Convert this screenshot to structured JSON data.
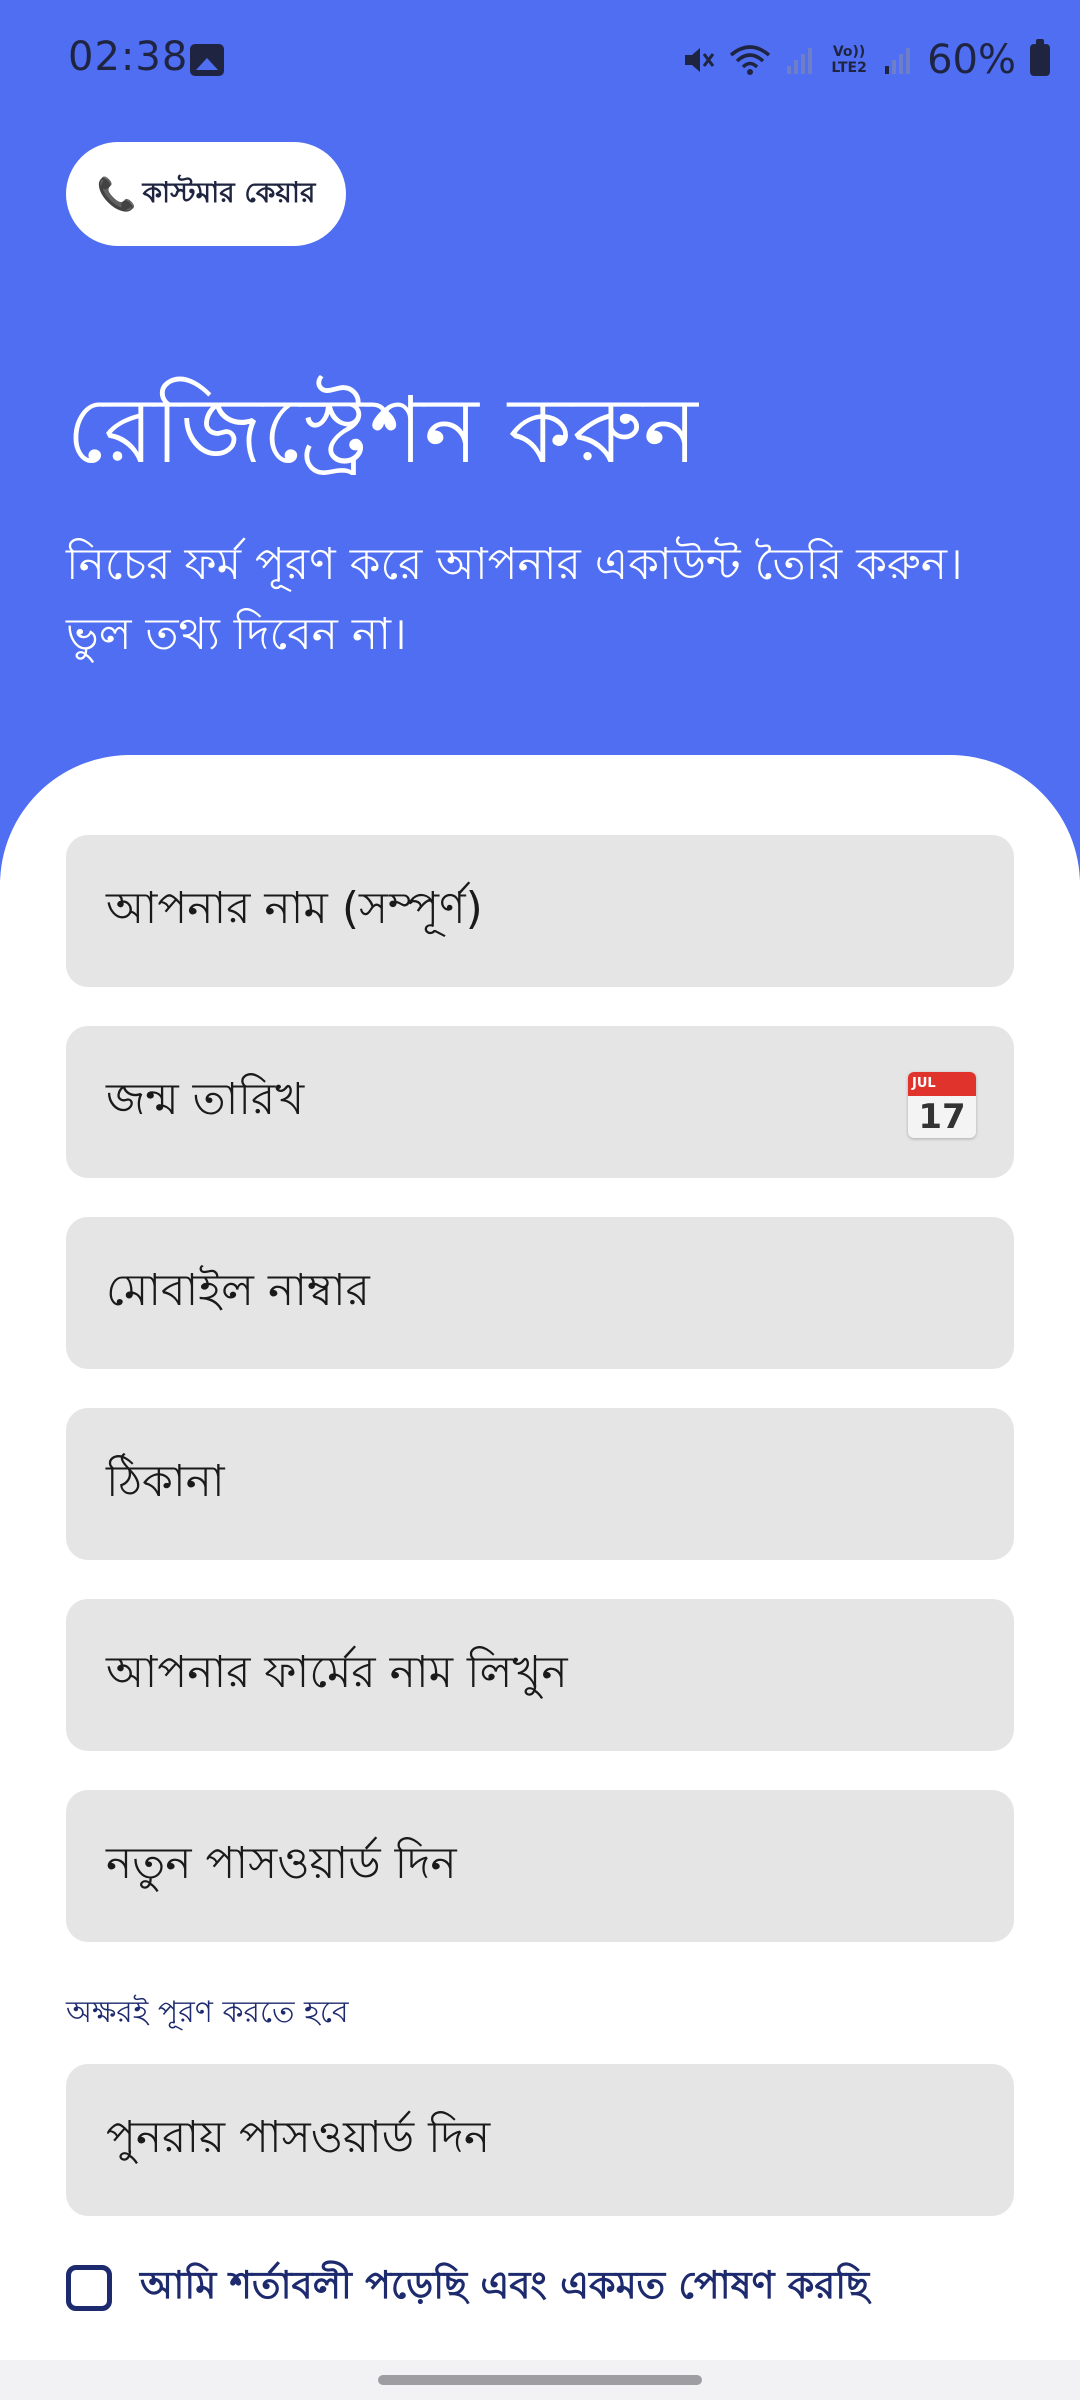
{
  "status_bar": {
    "time": "02:38",
    "battery": "60%",
    "network_label": "Vo)) LTE2"
  },
  "colors": {
    "header_bg": "#4f6ef2",
    "field_bg": "#e6e5e5",
    "accent_dark": "#1e2a6e"
  },
  "header": {
    "care_button_label": "কাস্টমার কেয়ার",
    "title": "রেজিস্ট্রেশন করুন",
    "subtitle": "নিচের ফর্ম পূরণ করে আপনার একাউন্ট তৈরি করুন। ভুল তথ্য দিবেন না।"
  },
  "form": {
    "full_name_placeholder": "আপনার নাম (সম্পূর্ণ)",
    "birth_date_placeholder": "জন্ম তারিখ",
    "calendar_month": "JUL",
    "calendar_day": "17",
    "mobile_placeholder": "মোবাইল নাম্বার",
    "address_placeholder": "ঠিকানা",
    "farm_name_placeholder": "আপনার ফার্মের নাম লিখুন",
    "new_password_placeholder": "নতুন পাসওয়ার্ড দিন",
    "password_hint": "অক্ষরই পূরণ করতে হবে",
    "confirm_password_placeholder": "পুনরায় পাসওয়ার্ড দিন",
    "terms_label": "আমি শর্তাবলী পড়েছি এবং একমত পোষণ করছি",
    "terms_checked": false
  }
}
